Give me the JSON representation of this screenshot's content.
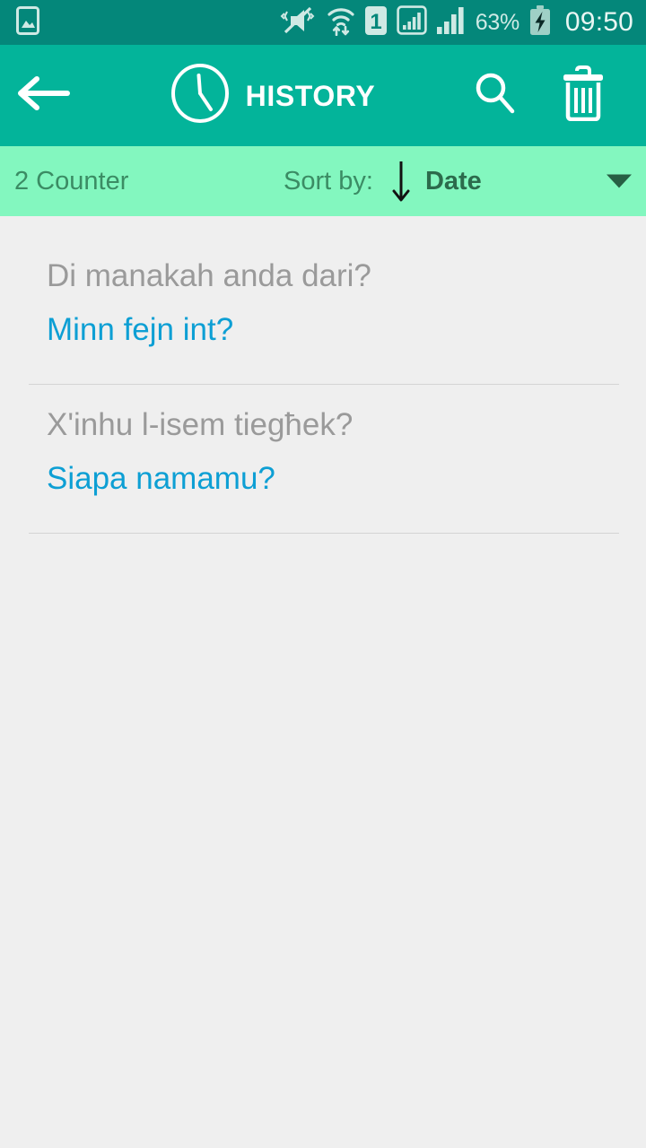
{
  "status_bar": {
    "icons": [
      "photo-gallery-icon",
      "vibrate-mute-icon",
      "wifi-icon",
      "sim-1-icon",
      "signal-bars-1-icon",
      "signal-bars-2-icon",
      "battery-charging-icon"
    ],
    "sim_label": "1",
    "battery_percent": "63%",
    "clock": "09:50",
    "background": "#04877a"
  },
  "toolbar": {
    "back_icon": "arrow-left-icon",
    "title_icon": "clock-icon",
    "title": "HISTORY",
    "search_icon": "search-icon",
    "delete_icon": "trash-icon",
    "background": "#03b49a",
    "text_color": "#ffffff"
  },
  "sort_bar": {
    "counter_label": "2 Counter",
    "sort_by_label": "Sort by:",
    "sort_direction_icon": "arrow-down-icon",
    "sort_value": "Date",
    "dropdown_icon": "caret-down-icon",
    "background": "#83f7bf",
    "text_color": "#3b8c64",
    "value_color": "#2c6b4c"
  },
  "history_list": {
    "source_color": "#9a9a9a",
    "target_color": "#0d9fd4",
    "items": [
      {
        "source_text": "Di manakah anda dari?",
        "target_text": "Minn fejn int?"
      },
      {
        "source_text": "X'inhu l-isem tiegħek?",
        "target_text": "Siapa namamu?"
      }
    ]
  }
}
